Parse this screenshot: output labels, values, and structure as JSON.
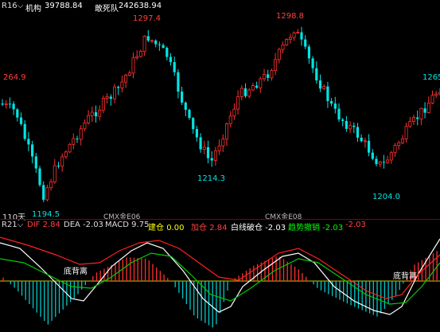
{
  "top_bar": {
    "indicator_id": "R16",
    "dropdown_glyph": "⌵",
    "field1_label": "机构",
    "field1_value": "39788.84",
    "field2_label": "敢死队",
    "field2_value": "242638.94",
    "field1_color": "#ffffff",
    "field2_color": "#ffffff"
  },
  "price_chart": {
    "peak_labels": [
      {
        "text": "1297.4",
        "color": "#ff4040"
      },
      {
        "text": "1298.8",
        "color": "#ff4040"
      },
      {
        "text": "264.9",
        "color": "#ff4040"
      },
      {
        "text": "1265",
        "color": "#00e5e5"
      }
    ],
    "trough_labels": [
      {
        "text": "1194.5",
        "color": "#00e5e5"
      },
      {
        "text": "1214.3",
        "color": "#00e5e5"
      },
      {
        "text": "1204.0",
        "color": "#00e5e5"
      }
    ],
    "period_label": "110天",
    "contract_labels": [
      "CMX金E06",
      "CMX金E08"
    ],
    "up_color": "#ff3030",
    "down_color": "#00e5e5"
  },
  "indicator_bar": {
    "indicator_id": "R21",
    "dropdown_glyph": "⌵",
    "items": [
      {
        "label": "DIF",
        "value": "2.84",
        "color": "#ff4040"
      },
      {
        "label": "DEA",
        "value": "-2.03",
        "color": "#dddddd"
      },
      {
        "label": "MACD",
        "value": "9.75",
        "color": "#dddddd"
      },
      {
        "label": "建仓",
        "value": "0.00",
        "color": "#ffff00"
      },
      {
        "label": "加仓",
        "value": "2.84",
        "color": "#ff4040"
      },
      {
        "label": "白线破仓",
        "value": "-2.03",
        "color": "#ffffff"
      },
      {
        "label": "趋势撤销",
        "value": "-2.03",
        "color": "#00ff00"
      },
      {
        "label": "",
        "value": "-2.03",
        "color": "#ff4040"
      }
    ]
  },
  "macd_chart": {
    "divergence_labels": [
      "底背离",
      "底背离"
    ],
    "zero_line_color": "#cccc00",
    "dif_color": "#ffffff",
    "dea_color": "#00cc00",
    "signal_color": "#ff2020",
    "pos_bar_color": "#ff3030",
    "neg_bar_color": "#00c8c8"
  }
}
